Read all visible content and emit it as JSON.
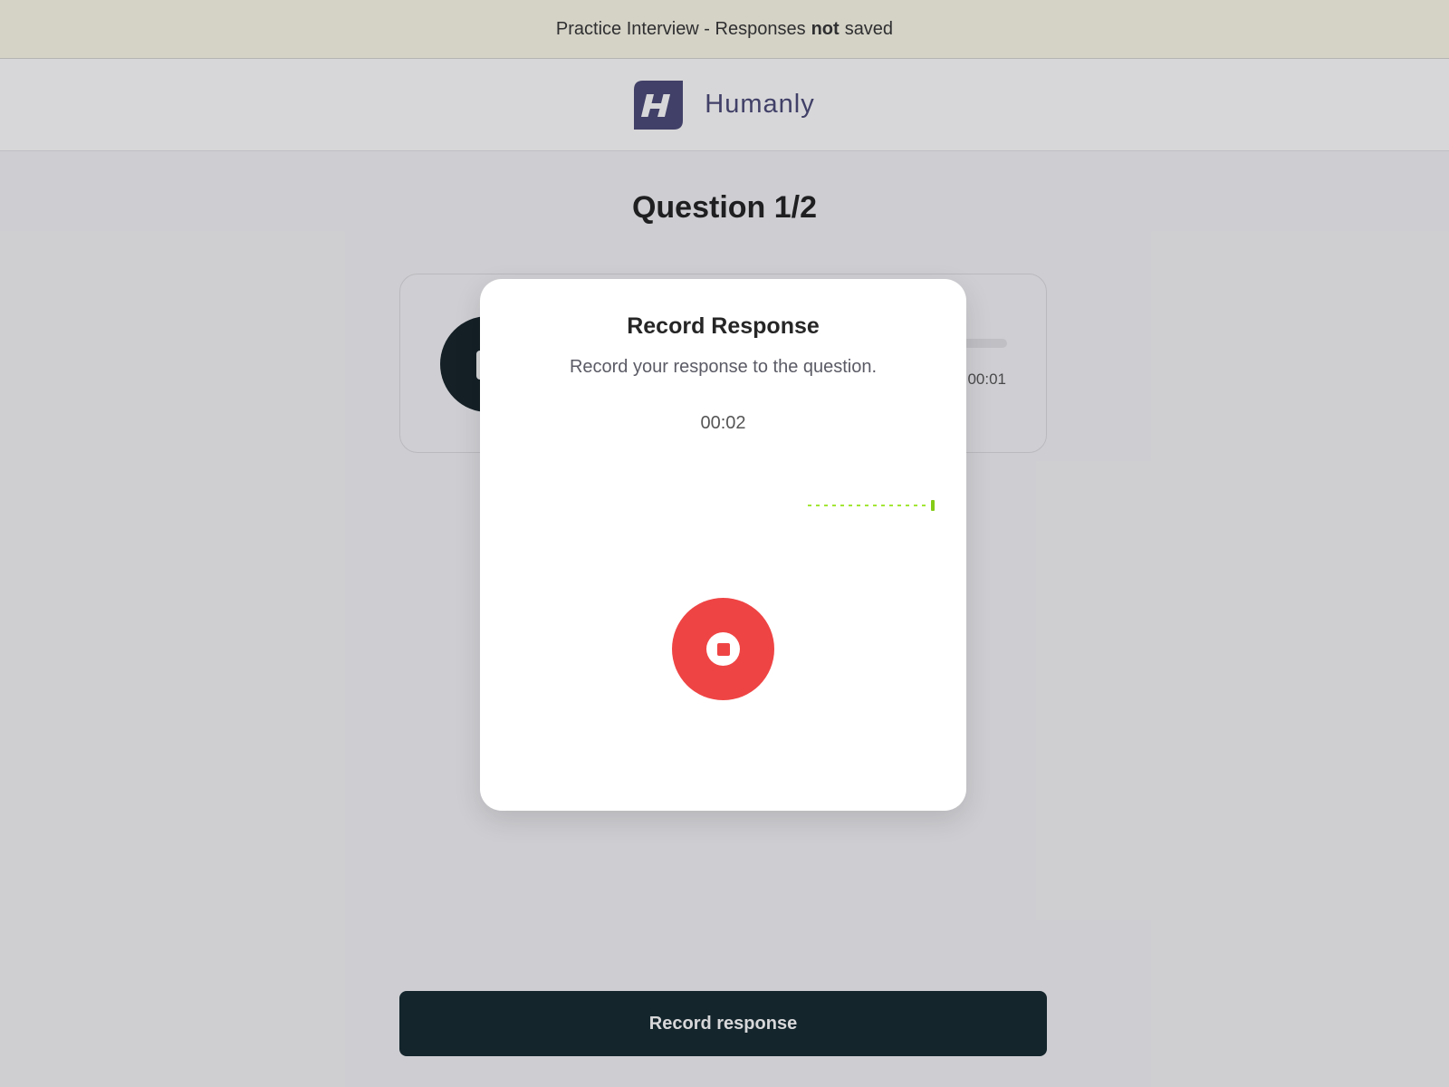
{
  "banner": {
    "prefix": "Practice Interview - Responses",
    "emphasis": "not",
    "suffix": "saved"
  },
  "header": {
    "brand_name": "Humanly",
    "logo_icon": "humanly-logo-icon",
    "brand_color": "#4b4a77"
  },
  "page": {
    "question_title": "Question 1/2",
    "audio_player": {
      "play_icon": "play-icon",
      "elapsed": "00:01",
      "progress": 0
    },
    "record_button_label": "Record response"
  },
  "modal": {
    "title": "Record Response",
    "subtitle": "Record your response to the question.",
    "timer": "00:02",
    "waveform_color": "#a3e635",
    "stop_button_icon": "stop-icon",
    "stop_button_color": "#ef4444"
  }
}
